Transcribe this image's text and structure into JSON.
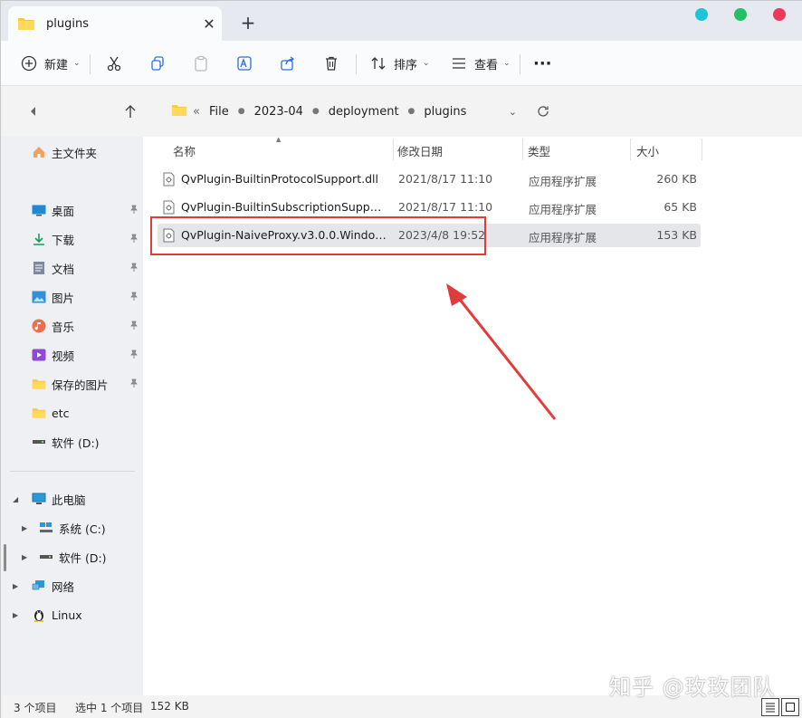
{
  "tab": {
    "title": "plugins",
    "close": "✕",
    "new_tab": "+"
  },
  "window_controls": {
    "colors": [
      "#1ec4d6",
      "#24c068",
      "#ea3a5a"
    ]
  },
  "toolbar": {
    "new_label": "新建",
    "sort_label": "排序",
    "view_label": "查看",
    "more": "···"
  },
  "address": {
    "overflow": "«",
    "crumbs": [
      "File",
      "2023-04",
      "deployment",
      "plugins"
    ]
  },
  "sidebar": {
    "home": "主文件夹",
    "quick": [
      {
        "label": "桌面",
        "icon": "desktop-icon",
        "pinned": true
      },
      {
        "label": "下载",
        "icon": "download-icon",
        "pinned": true
      },
      {
        "label": "文档",
        "icon": "documents-icon",
        "pinned": true
      },
      {
        "label": "图片",
        "icon": "pictures-icon",
        "pinned": true
      },
      {
        "label": "音乐",
        "icon": "music-icon",
        "pinned": true
      },
      {
        "label": "视频",
        "icon": "videos-icon",
        "pinned": true
      },
      {
        "label": "保存的图片",
        "icon": "folder-icon",
        "pinned": true
      },
      {
        "label": "etc",
        "icon": "folder-icon",
        "pinned": false
      },
      {
        "label": "软件 (D:)",
        "icon": "drive-icon",
        "pinned": false
      }
    ],
    "this_pc": "此电脑",
    "drives": [
      "系统 (C:)",
      "软件 (D:)"
    ],
    "network": "网络",
    "linux": "Linux"
  },
  "columns": {
    "name": "名称",
    "date": "修改日期",
    "type": "类型",
    "size": "大小"
  },
  "files": [
    {
      "name": "QvPlugin-BuiltinProtocolSupport.dll",
      "date": "2021/8/17 11:10",
      "type": "应用程序扩展",
      "size": "260 KB"
    },
    {
      "name": "QvPlugin-BuiltinSubscriptionSupport....",
      "date": "2021/8/17 11:10",
      "type": "应用程序扩展",
      "size": "65 KB"
    },
    {
      "name": "QvPlugin-NaiveProxy.v3.0.0.Windows....",
      "date": "2023/4/8 19:52",
      "type": "应用程序扩展",
      "size": "153 KB"
    }
  ],
  "status": {
    "count": "3 个项目",
    "selected": "选中 1 个项目",
    "size": "152 KB"
  },
  "watermark": "知乎 @玫玫团队"
}
